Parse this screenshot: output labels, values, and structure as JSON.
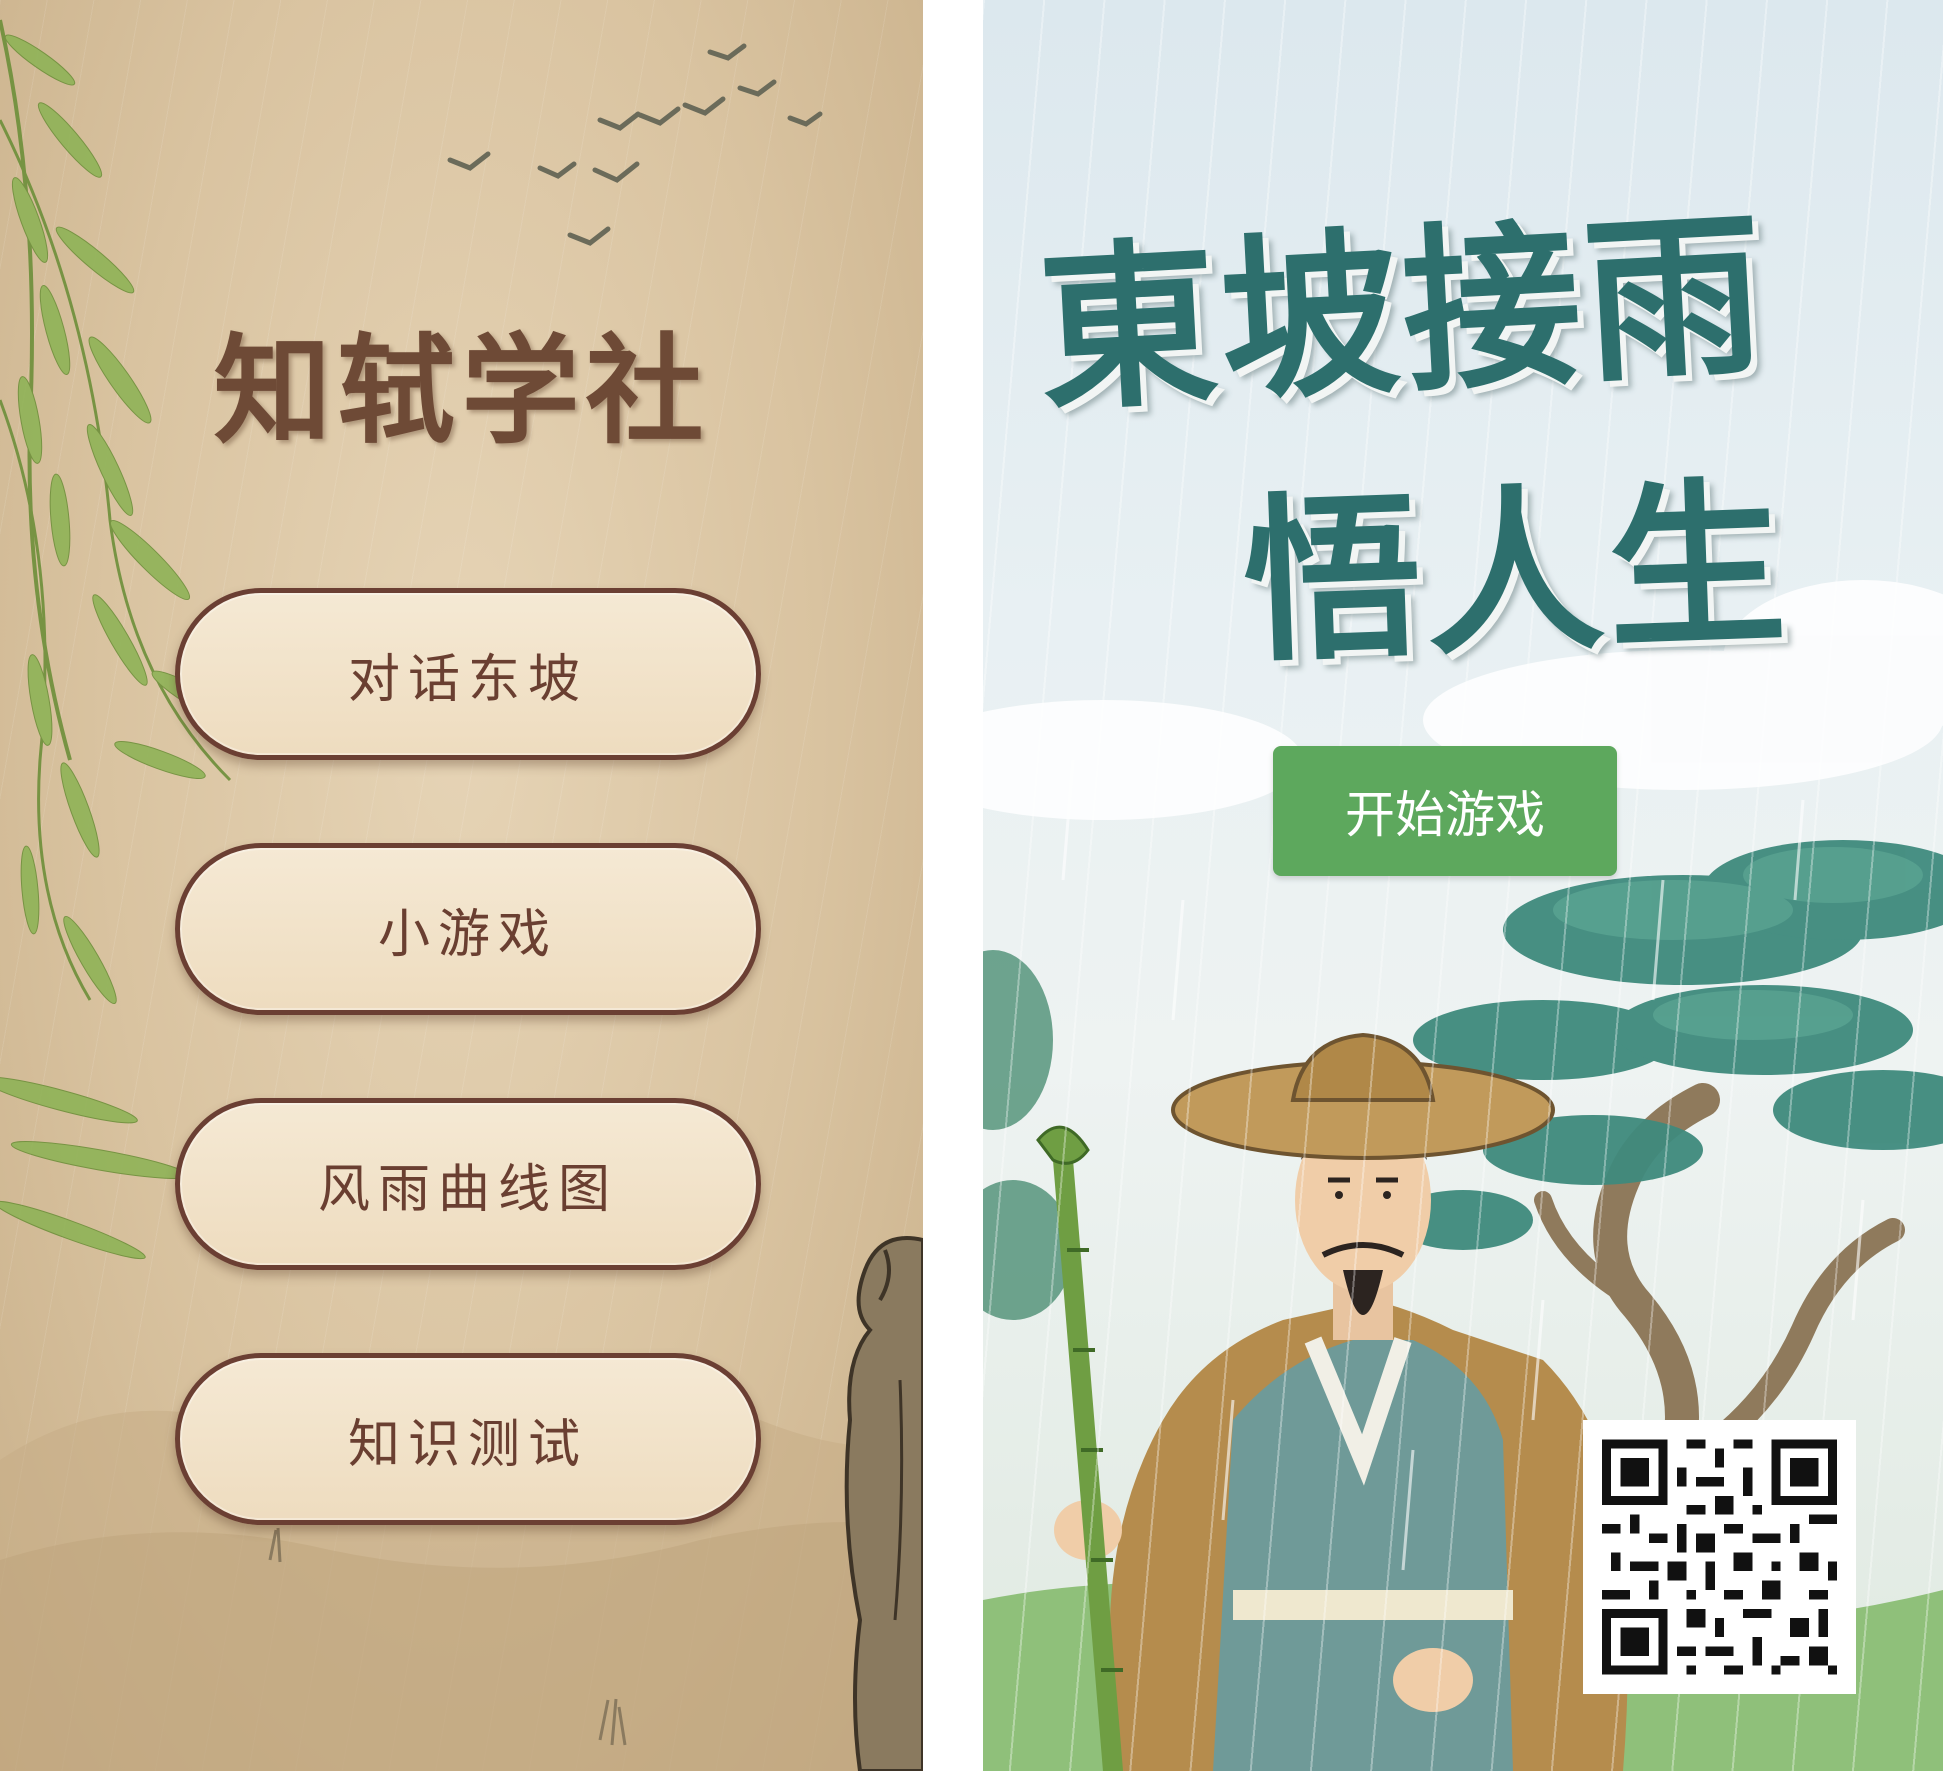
{
  "left_screen": {
    "title": "知轼学社",
    "menu": [
      {
        "label": "对话东坡"
      },
      {
        "label": "小游戏"
      },
      {
        "label": "风雨曲线图"
      },
      {
        "label": "知识测试"
      }
    ]
  },
  "right_screen": {
    "poster_title_line1": "東坡接雨",
    "poster_title_line2": "悟人生",
    "start_button_label": "开始游戏"
  },
  "colors": {
    "left_background": "#d9c3a0",
    "title_brown": "#6e4a36",
    "button_fill": "#f2e4cc",
    "button_border": "#6b3f33",
    "poster_title_teal": "#2d6f6d",
    "start_button_green": "#5da85d"
  },
  "icons": {
    "birds": "flying-birds-illustration",
    "willow": "willow-branches-illustration",
    "figure": "sudongpo-figure-illustration",
    "pine": "pine-tree-illustration",
    "qr": "qr-code"
  }
}
